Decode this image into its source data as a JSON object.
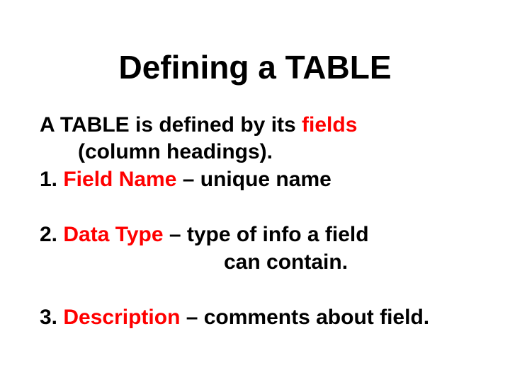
{
  "title": "Defining a TABLE",
  "intro": {
    "line1_pre": "A TABLE is defined by its ",
    "line1_red": "fields",
    "line2": "(column headings)."
  },
  "items": [
    {
      "num": "1. ",
      "red": "Field Name",
      "rest": " – unique name"
    },
    {
      "num": "2. ",
      "red": "Data Type",
      "rest_line1": " – type of info a field",
      "rest_line2": "can contain."
    },
    {
      "num": "3. ",
      "red": "Description",
      "rest": " – comments about field."
    }
  ]
}
